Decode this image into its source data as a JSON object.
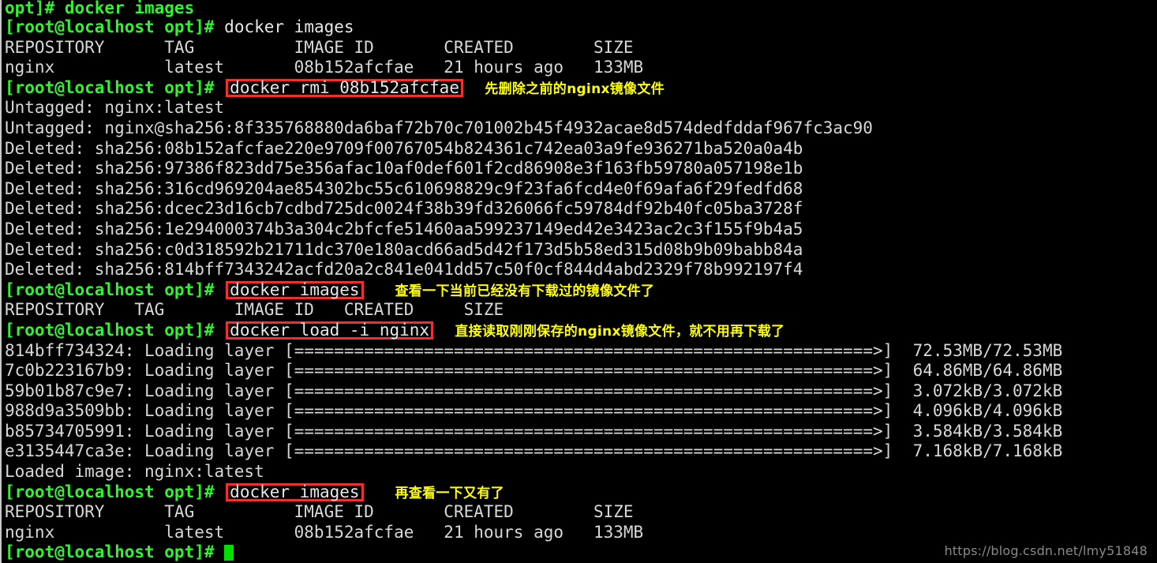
{
  "terminal": {
    "prompt": "[root@localhost opt]#",
    "watermark": "https://blog.csdn.net/lmy51848",
    "colors": {
      "background": "#000000",
      "foreground": "#d8d8d8",
      "prompt_green": "#2ef52e",
      "highlight_red": "#f03030",
      "annotation_yellow": "#ffff00",
      "cursor_green": "#00e000",
      "watermark_gray": "#8a8a8a"
    },
    "clipped_top_line": "opt]# docker images"
  },
  "commands": {
    "docker_images": "docker images",
    "docker_rmi": "docker rmi 08b152afcfae",
    "docker_load": "docker load -i nginx"
  },
  "annotations": {
    "rmi_note": "先删除之前的nginx镜像文件",
    "images_empty_note": "查看一下当前已经没有下载过的镜像文件了",
    "load_note": "直接读取刚刚保存的nginx镜像文件，就不用再下载了",
    "images_again_note": "再查看一下又有了"
  },
  "image_table_1": {
    "header": "REPOSITORY      TAG          IMAGE ID       CREATED        SIZE",
    "row": "nginx           latest       08b152afcfae   21 hours ago   133MB"
  },
  "image_table_empty": {
    "header": "REPOSITORY   TAG       IMAGE ID   CREATED     SIZE"
  },
  "image_table_2": {
    "header": "REPOSITORY      TAG          IMAGE ID       CREATED        SIZE",
    "row": "nginx           latest       08b152afcfae   21 hours ago   133MB"
  },
  "rmi_output": {
    "untagged_1": "Untagged: nginx:latest",
    "untagged_2": "Untagged: nginx@sha256:8f335768880da6baf72b70c701002b45f4932acae8d574dedfddaf967fc3ac90",
    "deleted": [
      "Deleted: sha256:08b152afcfae220e9709f00767054b824361c742ea03a9fe936271ba520a0a4b",
      "Deleted: sha256:97386f823dd75e356afac10af0def601f2cd86908e3f163fb59780a057198e1b",
      "Deleted: sha256:316cd969204ae854302bc55c610698829c9f23fa6fcd4e0f69afa6f29fedfd68",
      "Deleted: sha256:dcec23d16cb7cdbd725dc0024f38b39fd326066fc59784df92b40fc05ba3728f",
      "Deleted: sha256:1e294000374b3a304c2bfcfe51460aa599237149ed42e3423ac2c3f155f9b4a5",
      "Deleted: sha256:c0d318592b21711dc370e180acd66ad5d42f173d5b58ed315d08b9b09babb84a",
      "Deleted: sha256:814bff7343242acfd20a2c841e041dd57c50f0cf844d4abd2329f78b992197f4"
    ]
  },
  "load_output": {
    "progress_bar": "[==========================================================>]",
    "layers": [
      {
        "id": "814bff734324",
        "text": "Loading layer",
        "size": "72.53MB/72.53MB"
      },
      {
        "id": "7c0b223167b9",
        "text": "Loading layer",
        "size": "64.86MB/64.86MB"
      },
      {
        "id": "59b01b87c9e7",
        "text": "Loading layer",
        "size": "3.072kB/3.072kB"
      },
      {
        "id": "988d9a3509bb",
        "text": "Loading layer",
        "size": "4.096kB/4.096kB"
      },
      {
        "id": "b85734705991",
        "text": "Loading layer",
        "size": "3.584kB/3.584kB"
      },
      {
        "id": "e3135447ca3e",
        "text": "Loading layer",
        "size": "7.168kB/7.168kB"
      }
    ],
    "loaded_image": "Loaded image: nginx:latest"
  }
}
